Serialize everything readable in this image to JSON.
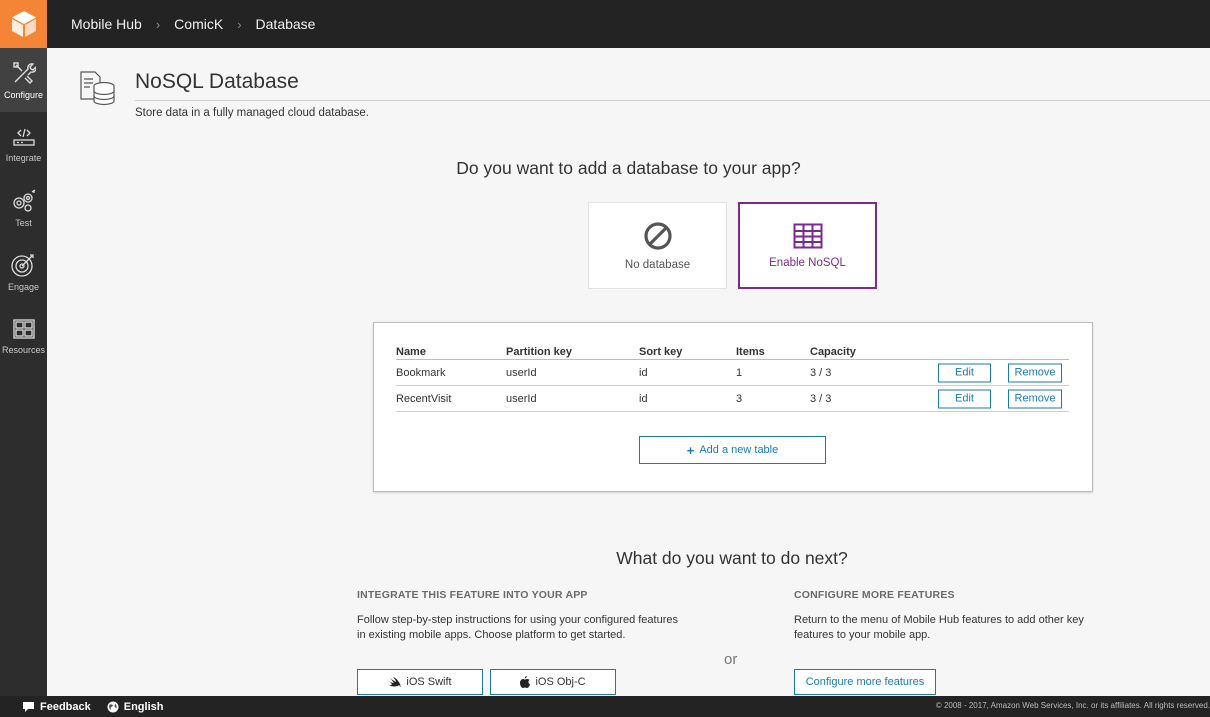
{
  "header": {
    "logo": "cube-icon",
    "breadcrumbs": [
      "Mobile Hub",
      "ComicK",
      "Database"
    ]
  },
  "sidebar": {
    "items": [
      {
        "label": "Configure",
        "icon": "tools-icon"
      },
      {
        "label": "Integrate",
        "icon": "code-icon"
      },
      {
        "label": "Test",
        "icon": "gears-icon"
      },
      {
        "label": "Engage",
        "icon": "target-icon"
      },
      {
        "label": "Resources",
        "icon": "grid-icon"
      }
    ]
  },
  "page": {
    "title": "NoSQL Database",
    "description": "Store data in a fully managed cloud database."
  },
  "question": "Do you want to add a database to your app?",
  "options": [
    {
      "label": "No database",
      "icon": "prohibited-icon",
      "selected": false
    },
    {
      "label": "Enable NoSQL",
      "icon": "table-icon",
      "selected": true
    }
  ],
  "table": {
    "columns": [
      "Name",
      "Partition key",
      "Sort key",
      "Items",
      "Capacity"
    ],
    "rows": [
      {
        "name": "Bookmark",
        "partition": "userId",
        "sort": "id",
        "items": "1",
        "capacity": "3 / 3"
      },
      {
        "name": "RecentVisit",
        "partition": "userId",
        "sort": "id",
        "items": "3",
        "capacity": "3 / 3"
      }
    ],
    "edit_label": "Edit",
    "remove_label": "Remove",
    "add_label": "Add a new table"
  },
  "next": {
    "title": "What do you want to do next?",
    "integrate_heading": "INTEGRATE THIS FEATURE INTO YOUR APP",
    "integrate_text": "Follow step-by-step instructions for using your configured features in existing mobile apps. Choose platform to get started.",
    "or_label": "or",
    "configure_heading": "CONFIGURE MORE FEATURES",
    "configure_text": "Return to the menu of Mobile Hub features to add other key features to your mobile app.",
    "ios_swift_label": "iOS Swift",
    "ios_objc_label": "iOS Obj-C",
    "configure_button_label": "Configure more features"
  },
  "footer": {
    "feedback_label": "Feedback",
    "language_label": "English",
    "copyright": "© 2008 - 2017, Amazon Web Services, Inc. or its affiliates. All rights reserved."
  },
  "colors": {
    "accent": "#f58536",
    "selected": "#7b2a8f",
    "link": "#1b7ab5",
    "topbar": "#232323"
  }
}
